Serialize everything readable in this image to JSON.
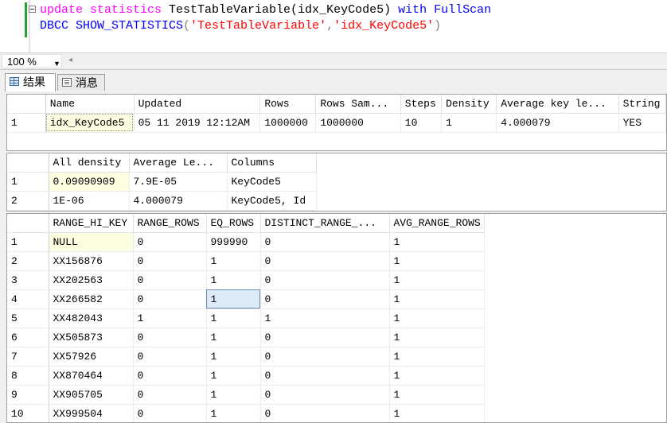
{
  "editor": {
    "line1": {
      "kw1": "update statistics",
      "name": " TestTableVariable(idx_KeyCode5) ",
      "kw2": "with FullScan"
    },
    "line2": {
      "kw": "DBCC SHOW_STATISTICS",
      "open": "(",
      "arg1": "'TestTableVariable'",
      "comma": ",",
      "arg2": "'idx_KeyCode5'",
      "close": ")"
    }
  },
  "zoom": {
    "value": "100 %"
  },
  "tabs": {
    "results": "结果",
    "messages": "消息"
  },
  "grid1": {
    "headers": [
      "Name",
      "Updated",
      "Rows",
      "Rows Sam...",
      "Steps",
      "Density",
      "Average key le...",
      "String"
    ],
    "rows": [
      {
        "num": "1",
        "cells": [
          "idx_KeyCode5",
          "05 11 2019 12:12AM",
          "1000000",
          "1000000",
          "10",
          "1",
          "4.000079",
          "YES"
        ]
      }
    ]
  },
  "grid2": {
    "headers": [
      "All density",
      "Average Le...",
      "Columns"
    ],
    "rows": [
      {
        "num": "1",
        "cells": [
          "0.09090909",
          "7.9E-05",
          "KeyCode5"
        ]
      },
      {
        "num": "2",
        "cells": [
          "1E-06",
          "4.000079",
          "KeyCode5, Id"
        ]
      }
    ]
  },
  "grid3": {
    "headers": [
      "RANGE_HI_KEY",
      "RANGE_ROWS",
      "EQ_ROWS",
      "DISTINCT_RANGE_...",
      "AVG_RANGE_ROWS"
    ],
    "rows": [
      {
        "num": "1",
        "cells": [
          "NULL",
          "0",
          "999990",
          "0",
          "1"
        ]
      },
      {
        "num": "2",
        "cells": [
          "XX156876",
          "0",
          "1",
          "0",
          "1"
        ]
      },
      {
        "num": "3",
        "cells": [
          "XX202563",
          "0",
          "1",
          "0",
          "1"
        ]
      },
      {
        "num": "4",
        "cells": [
          "XX266582",
          "0",
          "1",
          "0",
          "1"
        ]
      },
      {
        "num": "5",
        "cells": [
          "XX482043",
          "1",
          "1",
          "1",
          "1"
        ]
      },
      {
        "num": "6",
        "cells": [
          "XX505873",
          "0",
          "1",
          "0",
          "1"
        ]
      },
      {
        "num": "7",
        "cells": [
          "XX57926",
          "0",
          "1",
          "0",
          "1"
        ]
      },
      {
        "num": "8",
        "cells": [
          "XX870464",
          "0",
          "1",
          "0",
          "1"
        ]
      },
      {
        "num": "9",
        "cells": [
          "XX905705",
          "0",
          "1",
          "0",
          "1"
        ]
      },
      {
        "num": "10",
        "cells": [
          "XX999504",
          "0",
          "1",
          "0",
          "1"
        ]
      }
    ]
  }
}
